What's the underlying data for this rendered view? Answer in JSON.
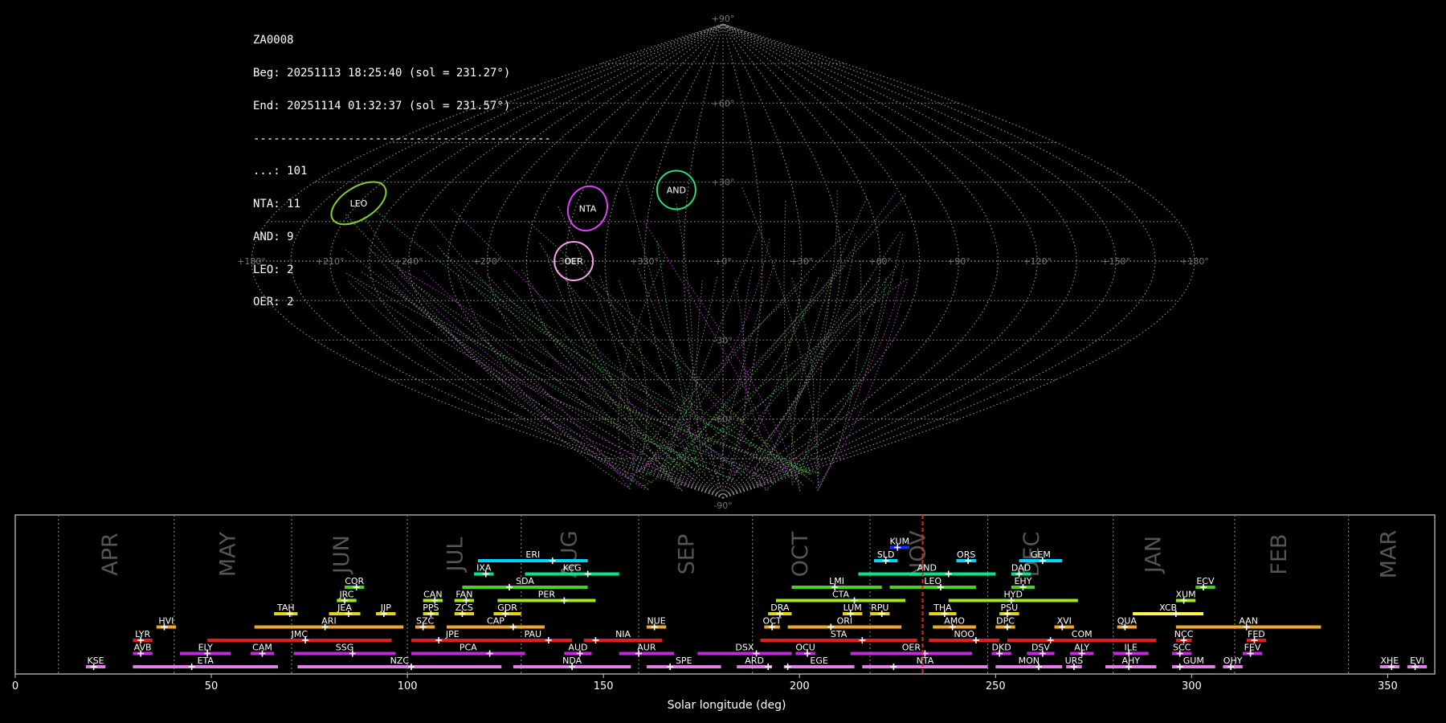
{
  "info": {
    "station": "ZA0008",
    "begin": "Beg: 20251113 18:25:40 (sol = 231.27°)",
    "end": "End: 20251114 01:32:37 (sol = 231.57°)",
    "separator": "--------------------------------------------",
    "counts": [
      {
        "label": "...: 101"
      },
      {
        "label": "NTA: 11"
      },
      {
        "label": "AND: 9"
      },
      {
        "label": "LEO: 2"
      },
      {
        "label": "OER: 2"
      }
    ]
  },
  "chart_data": [
    {
      "type": "scatter",
      "title": "",
      "projection": "sinusoidal",
      "lon_ticks": [
        "+180°",
        "+150°",
        "+120°",
        "+90°",
        "+60°",
        "+30°",
        "+0°",
        "+330°",
        "+300°",
        "+270°",
        "+240°",
        "+210°",
        "+180°"
      ],
      "lat_ticks": [
        "+90°",
        "+60°",
        "+30°",
        "-30°",
        "-60°",
        "-90°"
      ],
      "grid": true,
      "radiants": [
        {
          "name": "LEO",
          "lon": 150,
          "lat": 22,
          "color": "#7ed321"
        },
        {
          "name": "NTA",
          "lon": 55,
          "lat": 20,
          "color": "#e040fb"
        },
        {
          "name": "AND",
          "lon": 20,
          "lat": 27,
          "color": "#22e07a"
        },
        {
          "name": "OER",
          "lon": 57,
          "lat": 0,
          "color": "#ff9ff0"
        }
      ]
    },
    {
      "type": "bar",
      "xlabel": "Solar longitude (deg)",
      "xlim": [
        0,
        362
      ],
      "x_ticks": [
        "0",
        "50",
        "100",
        "150",
        "200",
        "250",
        "300",
        "350"
      ],
      "current_sol": 231.4,
      "months": [
        {
          "label": "APR",
          "pos": 24
        },
        {
          "label": "MAY",
          "pos": 54
        },
        {
          "label": "JUN",
          "pos": 83
        },
        {
          "label": "JUL",
          "pos": 112
        },
        {
          "label": "AUG",
          "pos": 141
        },
        {
          "label": "SEP",
          "pos": 171
        },
        {
          "label": "OCT",
          "pos": 200
        },
        {
          "label": "NOV",
          "pos": 230
        },
        {
          "label": "DEC",
          "pos": 259
        },
        {
          "label": "JAN",
          "pos": 290
        },
        {
          "label": "FEB",
          "pos": 322
        },
        {
          "label": "MAR",
          "pos": 350
        }
      ],
      "month_dividers": [
        11,
        40.5,
        70.5,
        100,
        129,
        159,
        188,
        218,
        248,
        280,
        311,
        340
      ],
      "showers": [
        {
          "name": "KUM",
          "start": 223,
          "end": 228,
          "peak": 225,
          "row": 9,
          "color": "#1a2bff"
        },
        {
          "name": "ERI",
          "start": 118,
          "end": 146,
          "peak": 137,
          "row": 8,
          "color": "#00d5ff"
        },
        {
          "name": "SLD",
          "start": 219,
          "end": 225,
          "peak": 222,
          "row": 8,
          "color": "#00d5ff"
        },
        {
          "name": "ORS",
          "start": 240,
          "end": 245,
          "peak": 243,
          "row": 8,
          "color": "#00d5ff"
        },
        {
          "name": "GEM",
          "start": 256,
          "end": 267,
          "peak": 262,
          "row": 8,
          "color": "#00d5ff"
        },
        {
          "name": "IXA",
          "start": 117,
          "end": 122,
          "peak": 120,
          "row": 7,
          "color": "#00e88a"
        },
        {
          "name": "KCG",
          "start": 130,
          "end": 154,
          "peak": 146,
          "row": 7,
          "color": "#00e88a"
        },
        {
          "name": "AND",
          "start": 215,
          "end": 250,
          "peak": 238,
          "row": 7,
          "color": "#00e88a"
        },
        {
          "name": "DAD",
          "start": 254,
          "end": 259,
          "peak": 256,
          "row": 7,
          "color": "#00e88a"
        },
        {
          "name": "COR",
          "start": 84,
          "end": 89,
          "peak": 87,
          "row": 6,
          "color": "#4ccf25"
        },
        {
          "name": "SDA",
          "start": 114,
          "end": 146,
          "peak": 126,
          "row": 6,
          "color": "#4ccf25"
        },
        {
          "name": "LMI",
          "start": 198,
          "end": 221,
          "peak": 209,
          "row": 6,
          "color": "#4ccf25"
        },
        {
          "name": "LEO",
          "start": 223,
          "end": 245,
          "peak": 236,
          "row": 6,
          "color": "#4ccf25"
        },
        {
          "name": "EHY",
          "start": 254,
          "end": 260,
          "peak": 257,
          "row": 6,
          "color": "#4ccf25"
        },
        {
          "name": "ECV",
          "start": 301,
          "end": 306,
          "peak": 303,
          "row": 6,
          "color": "#4ccf25"
        },
        {
          "name": "JRC",
          "start": 82,
          "end": 87,
          "peak": 84,
          "row": 5,
          "color": "#9be82f"
        },
        {
          "name": "CAN",
          "start": 104,
          "end": 109,
          "peak": 107,
          "row": 5,
          "color": "#9be82f"
        },
        {
          "name": "FAN",
          "start": 112,
          "end": 117,
          "peak": 115,
          "row": 5,
          "color": "#9be82f"
        },
        {
          "name": "PER",
          "start": 123,
          "end": 148,
          "peak": 140,
          "row": 5,
          "color": "#9be82f"
        },
        {
          "name": "CTA",
          "start": 194,
          "end": 227,
          "peak": 214,
          "row": 5,
          "color": "#9be82f"
        },
        {
          "name": "HYD",
          "start": 238,
          "end": 271,
          "peak": 254,
          "row": 5,
          "color": "#9be82f"
        },
        {
          "name": "XUM",
          "start": 296,
          "end": 301,
          "peak": 298,
          "row": 5,
          "color": "#9be82f"
        },
        {
          "name": "TAH",
          "start": 66,
          "end": 72,
          "peak": 70,
          "row": 4,
          "color": "#e5d21a"
        },
        {
          "name": "JEA",
          "start": 80,
          "end": 88,
          "peak": 85,
          "row": 4,
          "color": "#e5d21a"
        },
        {
          "name": "JIP",
          "start": 92,
          "end": 97,
          "peak": 94,
          "row": 4,
          "color": "#e5d21a"
        },
        {
          "name": "PPS",
          "start": 104,
          "end": 108,
          "peak": 106,
          "row": 4,
          "color": "#e5d21a"
        },
        {
          "name": "ZCS",
          "start": 112,
          "end": 117,
          "peak": 114,
          "row": 4,
          "color": "#e5d21a"
        },
        {
          "name": "GDR",
          "start": 122,
          "end": 129,
          "peak": 125,
          "row": 4,
          "color": "#e5d21a"
        },
        {
          "name": "DRA",
          "start": 192,
          "end": 198,
          "peak": 195,
          "row": 4,
          "color": "#e5d21a"
        },
        {
          "name": "LUM",
          "start": 211,
          "end": 216,
          "peak": 213,
          "row": 4,
          "color": "#e5d21a"
        },
        {
          "name": "RPU",
          "start": 218,
          "end": 223,
          "peak": 221,
          "row": 4,
          "color": "#e5d21a"
        },
        {
          "name": "THA",
          "start": 233,
          "end": 240,
          "peak": 237,
          "row": 4,
          "color": "#e5d21a"
        },
        {
          "name": "PSU",
          "start": 251,
          "end": 256,
          "peak": 253,
          "row": 4,
          "color": "#e5d21a"
        },
        {
          "name": "XCB",
          "start": 285,
          "end": 303,
          "peak": 296,
          "row": 4,
          "color": "#fff44f"
        },
        {
          "name": "HVI",
          "start": 36,
          "end": 41,
          "peak": 38,
          "row": 3,
          "color": "#f5a623"
        },
        {
          "name": "ARI",
          "start": 61,
          "end": 99,
          "peak": 79,
          "row": 3,
          "color": "#f5a623"
        },
        {
          "name": "SZC",
          "start": 102,
          "end": 107,
          "peak": 104,
          "row": 3,
          "color": "#f5a623"
        },
        {
          "name": "CAP",
          "start": 110,
          "end": 135,
          "peak": 127,
          "row": 3,
          "color": "#f5a623"
        },
        {
          "name": "NUE",
          "start": 161,
          "end": 166,
          "peak": 163,
          "row": 3,
          "color": "#f5a623"
        },
        {
          "name": "OCT",
          "start": 191,
          "end": 195,
          "peak": 193,
          "row": 3,
          "color": "#f5a623"
        },
        {
          "name": "ORI",
          "start": 197,
          "end": 226,
          "peak": 208,
          "row": 3,
          "color": "#f5a623"
        },
        {
          "name": "AMO",
          "start": 234,
          "end": 245,
          "peak": 239,
          "row": 3,
          "color": "#f5a623"
        },
        {
          "name": "DPC",
          "start": 250,
          "end": 255,
          "peak": 253,
          "row": 3,
          "color": "#f5a623"
        },
        {
          "name": "XVI",
          "start": 265,
          "end": 270,
          "peak": 267,
          "row": 3,
          "color": "#f5a623"
        },
        {
          "name": "QUA",
          "start": 281,
          "end": 286,
          "peak": 283,
          "row": 3,
          "color": "#f5a623"
        },
        {
          "name": "AAN",
          "start": 296,
          "end": 333,
          "peak": 314,
          "row": 3,
          "color": "#f5a623"
        },
        {
          "name": "LYR",
          "start": 30,
          "end": 35,
          "peak": 32,
          "row": 2,
          "color": "#e21d1d"
        },
        {
          "name": "JMC",
          "start": 49,
          "end": 96,
          "peak": 74,
          "row": 2,
          "color": "#e21d1d"
        },
        {
          "name": "JPE",
          "start": 101,
          "end": 122,
          "peak": 108,
          "row": 2,
          "color": "#e21d1d"
        },
        {
          "name": "PAU",
          "start": 122,
          "end": 142,
          "peak": 136,
          "row": 2,
          "color": "#e21d1d"
        },
        {
          "name": "NIA",
          "start": 145,
          "end": 165,
          "peak": 148,
          "row": 2,
          "color": "#e21d1d"
        },
        {
          "name": "STA",
          "start": 190,
          "end": 230,
          "peak": 216,
          "row": 2,
          "color": "#e21d1d"
        },
        {
          "name": "NOO",
          "start": 233,
          "end": 251,
          "peak": 245,
          "row": 2,
          "color": "#e21d1d"
        },
        {
          "name": "COM",
          "start": 253,
          "end": 291,
          "peak": 264,
          "row": 2,
          "color": "#e21d1d"
        },
        {
          "name": "NCC",
          "start": 296,
          "end": 300,
          "peak": 298,
          "row": 2,
          "color": "#e21d1d"
        },
        {
          "name": "FED",
          "start": 314,
          "end": 319,
          "peak": 316,
          "row": 2,
          "color": "#e21d1d"
        },
        {
          "name": "AVB",
          "start": 30,
          "end": 35,
          "peak": 32,
          "row": 1,
          "color": "#c02cd8"
        },
        {
          "name": "ELY",
          "start": 42,
          "end": 55,
          "peak": 49,
          "row": 1,
          "color": "#c02cd8"
        },
        {
          "name": "CAM",
          "start": 60,
          "end": 66,
          "peak": 63,
          "row": 1,
          "color": "#c02cd8"
        },
        {
          "name": "SSG",
          "start": 71,
          "end": 97,
          "peak": 86,
          "row": 1,
          "color": "#c02cd8"
        },
        {
          "name": "PCA",
          "start": 101,
          "end": 130,
          "peak": 121,
          "row": 1,
          "color": "#c02cd8"
        },
        {
          "name": "AUD",
          "start": 140,
          "end": 147,
          "peak": 144,
          "row": 1,
          "color": "#c02cd8"
        },
        {
          "name": "AUR",
          "start": 154,
          "end": 168,
          "peak": 159,
          "row": 1,
          "color": "#c02cd8"
        },
        {
          "name": "DSX",
          "start": 174,
          "end": 198,
          "peak": 189,
          "row": 1,
          "color": "#c02cd8"
        },
        {
          "name": "OCU",
          "start": 199,
          "end": 204,
          "peak": 202,
          "row": 1,
          "color": "#c02cd8"
        },
        {
          "name": "OER",
          "start": 213,
          "end": 244,
          "peak": 232,
          "row": 1,
          "color": "#c02cd8"
        },
        {
          "name": "DKD",
          "start": 249,
          "end": 254,
          "peak": 251,
          "row": 1,
          "color": "#c02cd8"
        },
        {
          "name": "DSV",
          "start": 258,
          "end": 265,
          "peak": 262,
          "row": 1,
          "color": "#c02cd8"
        },
        {
          "name": "ALY",
          "start": 269,
          "end": 275,
          "peak": 272,
          "row": 1,
          "color": "#c02cd8"
        },
        {
          "name": "ILE",
          "start": 280,
          "end": 289,
          "peak": 284,
          "row": 1,
          "color": "#c02cd8"
        },
        {
          "name": "SCC",
          "start": 295,
          "end": 300,
          "peak": 297,
          "row": 1,
          "color": "#c02cd8"
        },
        {
          "name": "FEV",
          "start": 313,
          "end": 318,
          "peak": 315,
          "row": 1,
          "color": "#c02cd8"
        },
        {
          "name": "KSE",
          "start": 18,
          "end": 23,
          "peak": 20,
          "row": 0,
          "color": "#e07ee8"
        },
        {
          "name": "ETA",
          "start": 30,
          "end": 67,
          "peak": 45,
          "row": 0,
          "color": "#e07ee8"
        },
        {
          "name": "NZC",
          "start": 72,
          "end": 124,
          "peak": 101,
          "row": 0,
          "color": "#e07ee8"
        },
        {
          "name": "NDA",
          "start": 127,
          "end": 157,
          "peak": 142,
          "row": 0,
          "color": "#e07ee8"
        },
        {
          "name": "SPE",
          "start": 161,
          "end": 180,
          "peak": 167,
          "row": 0,
          "color": "#e07ee8"
        },
        {
          "name": "ARD",
          "start": 184,
          "end": 193,
          "peak": 192,
          "row": 0,
          "color": "#e07ee8"
        },
        {
          "name": "EGE",
          "start": 196,
          "end": 214,
          "peak": 197,
          "row": 0,
          "color": "#e07ee8"
        },
        {
          "name": "NTA",
          "start": 216,
          "end": 248,
          "peak": 224,
          "row": 0,
          "color": "#e07ee8"
        },
        {
          "name": "MON",
          "start": 250,
          "end": 267,
          "peak": 261,
          "row": 0,
          "color": "#e07ee8"
        },
        {
          "name": "URS",
          "start": 268,
          "end": 272,
          "peak": 270,
          "row": 0,
          "color": "#e07ee8"
        },
        {
          "name": "AHY",
          "start": 278,
          "end": 291,
          "peak": 284,
          "row": 0,
          "color": "#e07ee8"
        },
        {
          "name": "GUM",
          "start": 295,
          "end": 306,
          "peak": 297,
          "row": 0,
          "color": "#e07ee8"
        },
        {
          "name": "OHY",
          "start": 308,
          "end": 313,
          "peak": 310,
          "row": 0,
          "color": "#e07ee8"
        },
        {
          "name": "XHE",
          "start": 348,
          "end": 353,
          "peak": 351,
          "row": 0,
          "color": "#e07ee8"
        },
        {
          "name": "EVI",
          "start": 355,
          "end": 360,
          "peak": 357,
          "row": 0,
          "color": "#e07ee8"
        }
      ]
    }
  ]
}
